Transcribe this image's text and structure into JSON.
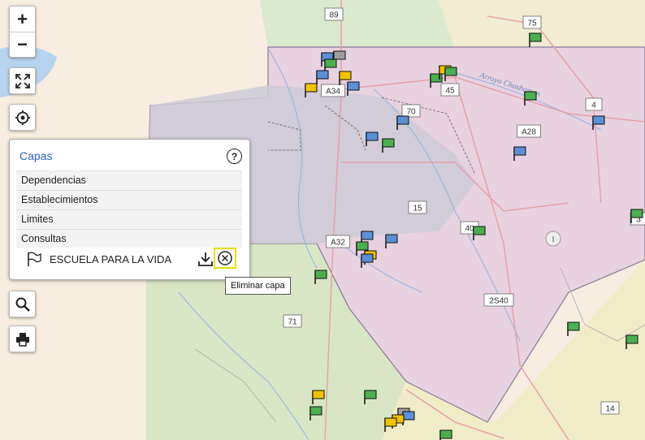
{
  "map": {
    "routes": [
      "89",
      "75",
      "A34",
      "45",
      "70",
      "4",
      "A28",
      "15",
      "40",
      "A32",
      "2S40",
      "71",
      "14",
      "3"
    ],
    "water_label": "Arroyo Chashamen",
    "legend_marker": "I",
    "markers": [
      {
        "color": "#4caf50"
      },
      {
        "color": "#5b8fd6"
      },
      {
        "color": "#f2c200"
      },
      {
        "color": "#9e9e9e"
      }
    ]
  },
  "controls": {
    "zoom_in": "+",
    "zoom_out": "−",
    "fullscreen_icon": "expand-icon",
    "locate_icon": "crosshair-icon",
    "search_icon": "search-icon",
    "print_icon": "print-icon"
  },
  "layers_panel": {
    "title": "Capas",
    "help": "?",
    "items": [
      {
        "label": "Dependencias"
      },
      {
        "label": "Establecimientos"
      },
      {
        "label": "Limites"
      },
      {
        "label": "Consultas"
      }
    ],
    "query_layer": {
      "label": "ESCUELA PARA LA VIDA",
      "flag_icon": "flag-icon",
      "download_icon": "download-icon",
      "remove_icon": "close-circle-icon"
    },
    "tooltip": "Eliminar capa"
  },
  "colors": {
    "pink_region": "#e8d2e0",
    "gray_region": "#cdcbd6",
    "green_region": "#d8e6c6",
    "yellow_region": "#f1ecc8",
    "accent": "#2e63c4",
    "highlight": "#e8e000"
  }
}
